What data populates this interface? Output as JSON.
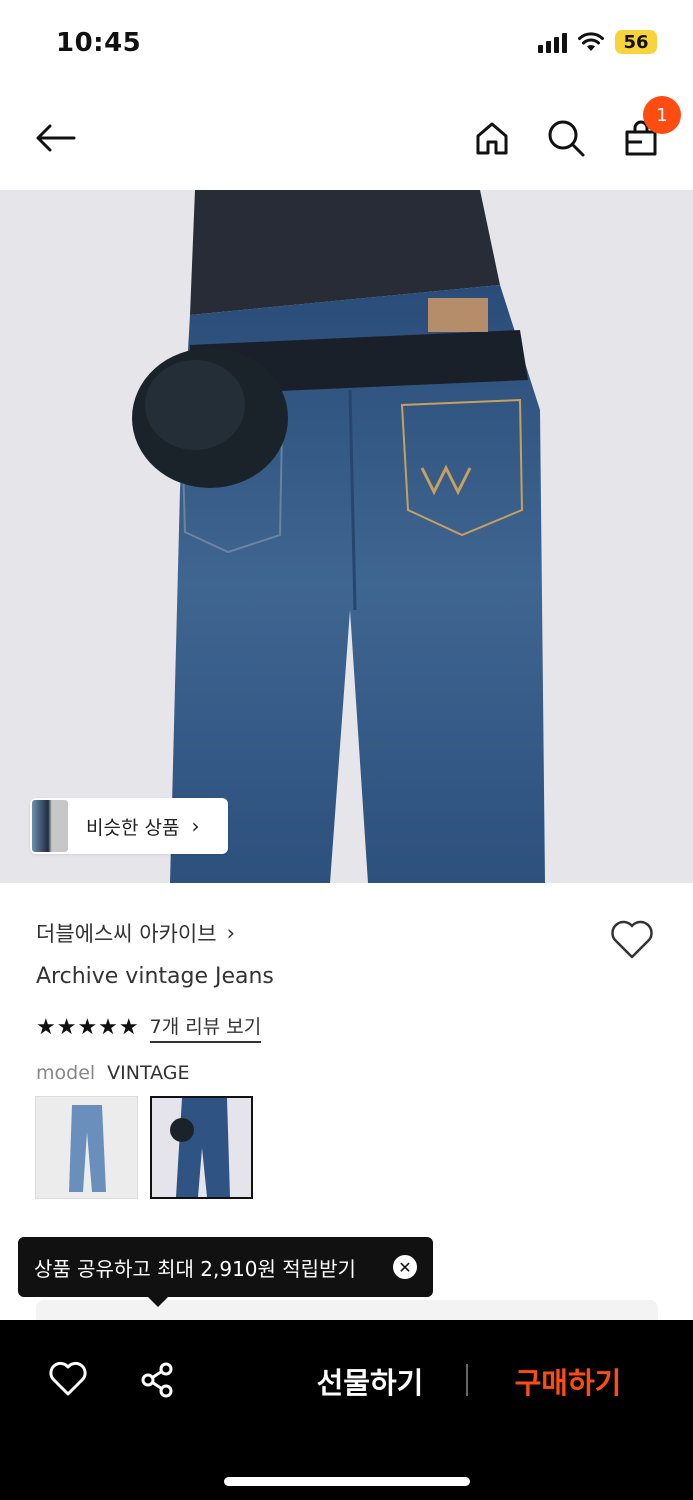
{
  "status_bar": {
    "time": "10:45",
    "battery": "56"
  },
  "nav": {
    "cart_count": "1"
  },
  "hero": {
    "similar_label": "비슷한 상품"
  },
  "product": {
    "brand": "더블에스씨 아카이브",
    "name": "Archive vintage Jeans",
    "stars": "★★★★★",
    "review_link": "7개 리뷰 보기",
    "option_label": "model",
    "option_value": "VINTAGE"
  },
  "tooltip": {
    "text": "상품 공유하고 최대 2,910원 적립받기"
  },
  "bottom_bar": {
    "gift_label": "선물하기",
    "buy_label": "구매하기"
  },
  "colors": {
    "accent": "#ff4d12",
    "battery": "#f7d43b"
  }
}
